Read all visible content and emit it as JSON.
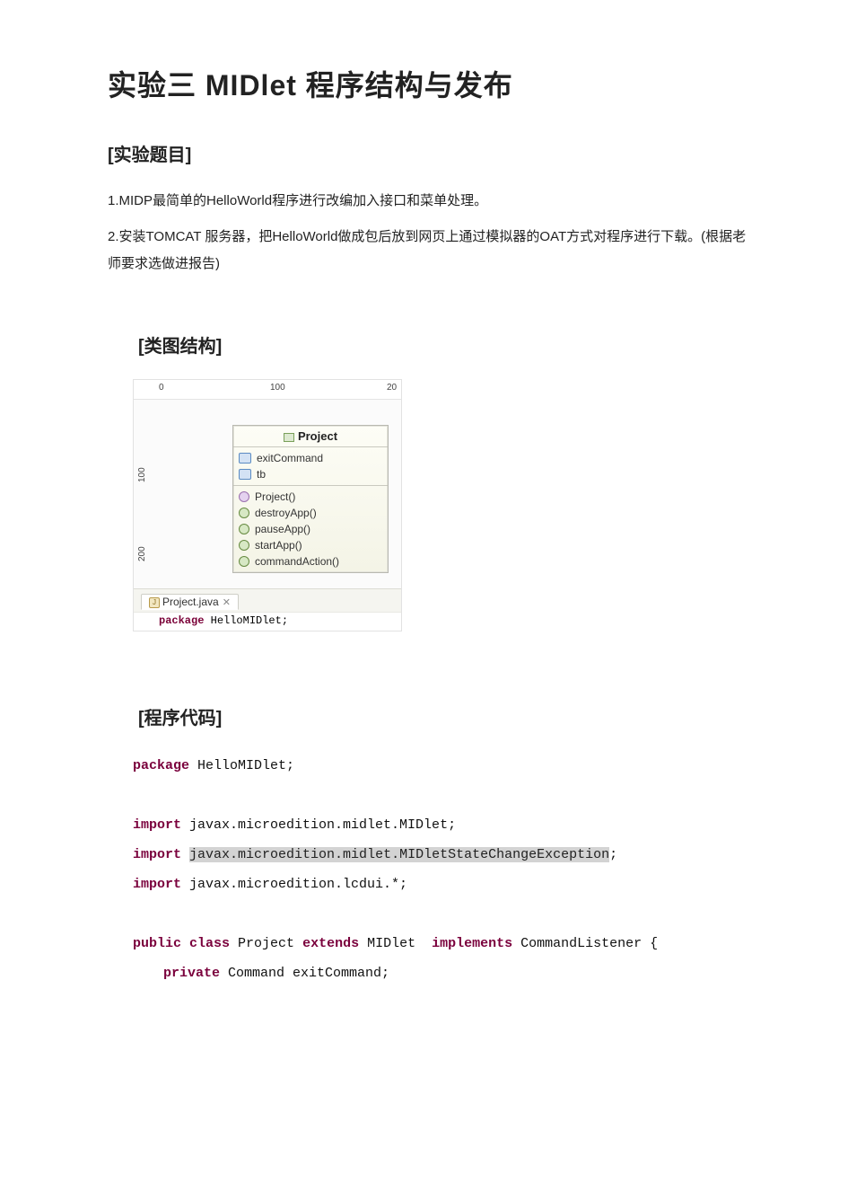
{
  "title": "实验三 MIDlet 程序结构与发布",
  "sections": {
    "topic_heading": "[实验题目]",
    "topic_1": "1.MIDP最简单的HelloWorld程序进行改编加入接口和菜单处理。",
    "topic_2": "2.安装TOMCAT 服务器，把HelloWorld做成包后放到网页上通过模拟器的OAT方式对程序进行下载。(根据老师要求选做进报告)",
    "class_diagram_heading": "[类图结构]",
    "code_heading": "[程序代码]"
  },
  "diagram": {
    "ruler_top": {
      "n0": "0",
      "n100": "100",
      "n200": "20"
    },
    "ruler_left": {
      "n100": "100",
      "n200": "200"
    },
    "class_name": "Project",
    "fields": [
      "exitCommand",
      "tb"
    ],
    "methods": [
      "Project()",
      "destroyApp()",
      "pauseApp()",
      "startApp()",
      "commandAction()"
    ],
    "tab_label": "Project.java",
    "editor_preview_kw": "package",
    "editor_preview_rest": " HelloMIDlet;"
  },
  "code": {
    "kw_package": "package",
    "pkg_name": " HelloMIDlet;",
    "kw_import": "import",
    "import1": " javax.microedition.midlet.MIDlet;",
    "import2_hl": "javax.microedition.midlet.MIDletStateChangeException",
    "import2_tail": ";",
    "import3": " javax.microedition.lcdui.*;",
    "kw_public": "public",
    "kw_class": "class",
    "cls_name": " Project ",
    "kw_extends": "extends",
    "extends_name": " MIDlet  ",
    "kw_implements": "implements",
    "impl_name": " CommandListener {",
    "kw_private": "private",
    "priv_rest": " Command exitCommand;"
  }
}
